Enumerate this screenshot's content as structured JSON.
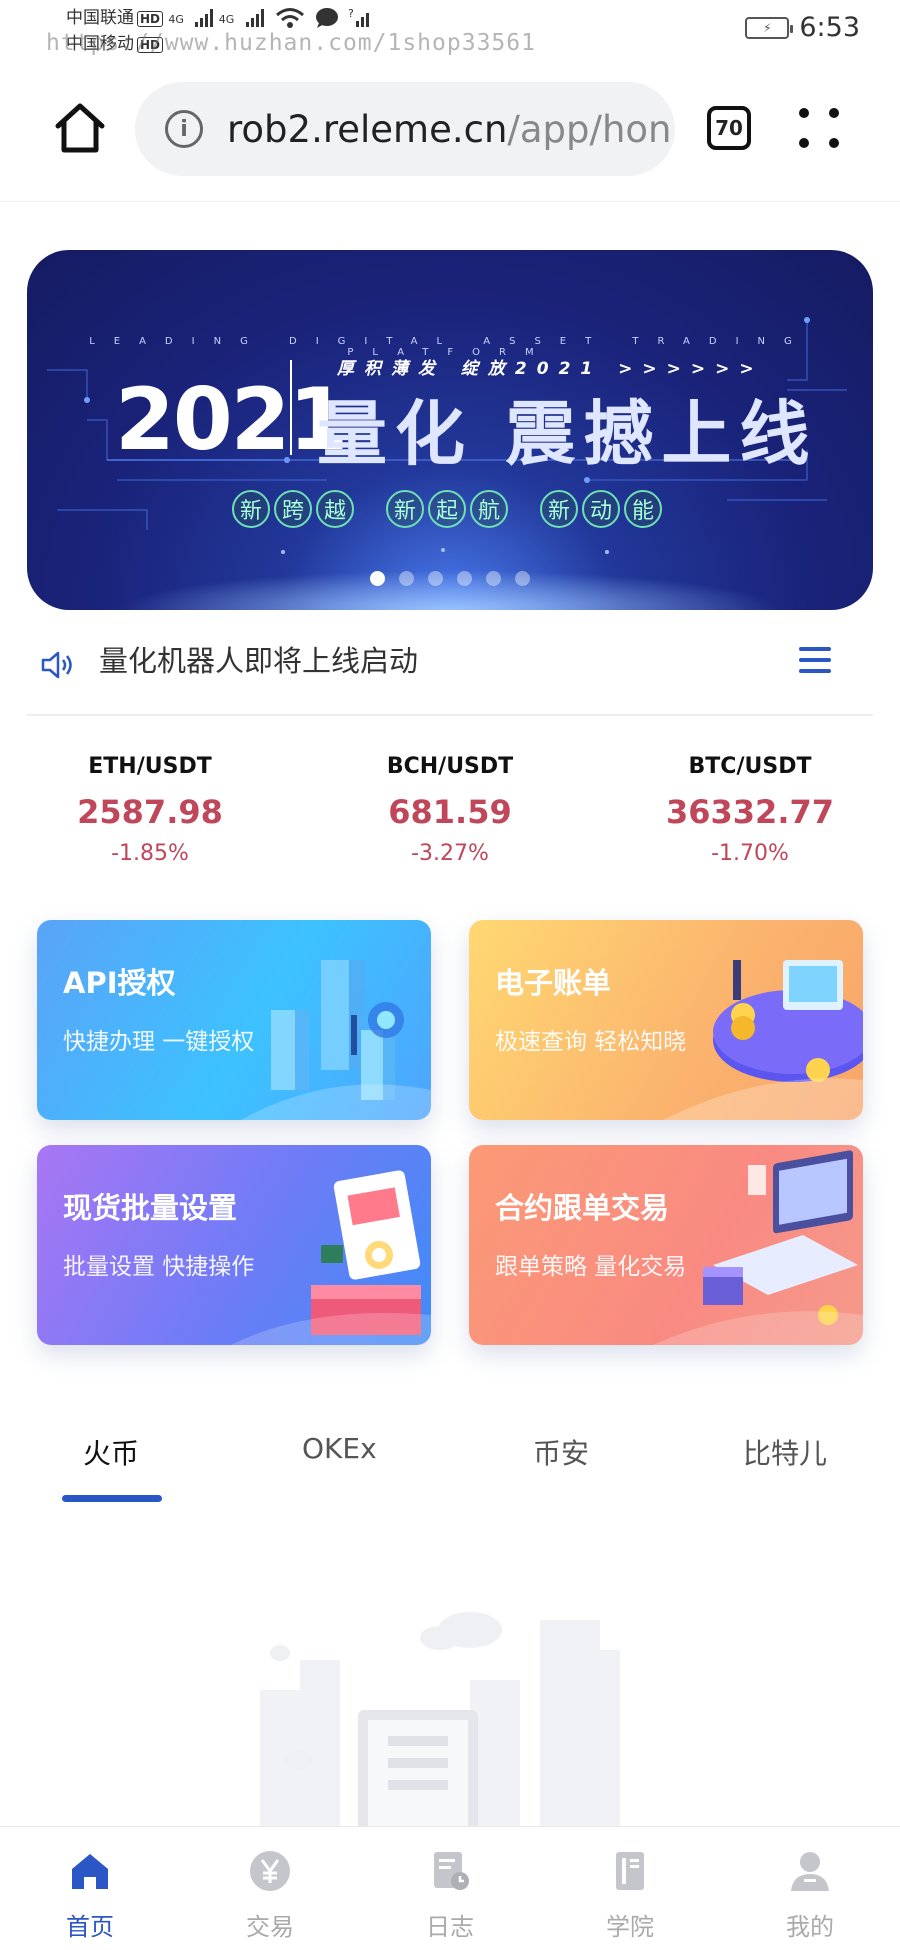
{
  "status_bar": {
    "carrier1": "中国联通",
    "carrier2": "中国移动",
    "hd_badge": "HD",
    "network": "4G",
    "time": "6:53",
    "watermark": "https://www.huzhan.com/1shop33561"
  },
  "browser": {
    "url_domain": "rob2.releme.cn",
    "url_path": "/app/hon",
    "tab_count": "70"
  },
  "banner": {
    "top_line": "LEADING DIGITAL ASSET TRADING PLATFORM",
    "subline": "厚积薄发  绽放2021 >>>>>>",
    "year": "2021",
    "title": "量化 震撼上线",
    "tags": [
      [
        "新",
        "跨",
        "越"
      ],
      [
        "新",
        "起",
        "航"
      ],
      [
        "新",
        "动",
        "能"
      ]
    ],
    "slide_count": 6,
    "active_slide": 0
  },
  "notice": {
    "text": "量化机器人即将上线启动"
  },
  "tickers": [
    {
      "pair": "ETH/USDT",
      "price": "2587.98",
      "change": "-1.85%"
    },
    {
      "pair": "BCH/USDT",
      "price": "681.59",
      "change": "-3.27%"
    },
    {
      "pair": "BTC/USDT",
      "price": "36332.77",
      "change": "-1.70%"
    }
  ],
  "cards": [
    {
      "title": "API授权",
      "subtitle": "快捷办理 一键授权"
    },
    {
      "title": "电子账单",
      "subtitle": "极速查询 轻松知晓"
    },
    {
      "title": "现货批量设置",
      "subtitle": "批量设置 快捷操作"
    },
    {
      "title": "合约跟单交易",
      "subtitle": "跟单策略 量化交易"
    }
  ],
  "exchange_tabs": [
    "火币",
    "OKEx",
    "币安",
    "比特儿"
  ],
  "active_exchange_tab": 0,
  "bottom_nav": [
    {
      "label": "首页",
      "icon": "home-icon"
    },
    {
      "label": "交易",
      "icon": "yuan-coin-icon"
    },
    {
      "label": "日志",
      "icon": "log-icon"
    },
    {
      "label": "学院",
      "icon": "book-icon"
    },
    {
      "label": "我的",
      "icon": "user-icon"
    }
  ],
  "colors": {
    "accent": "#2a56c6",
    "price_down": "#c0475a",
    "nav_inactive": "#aaaaaa"
  }
}
